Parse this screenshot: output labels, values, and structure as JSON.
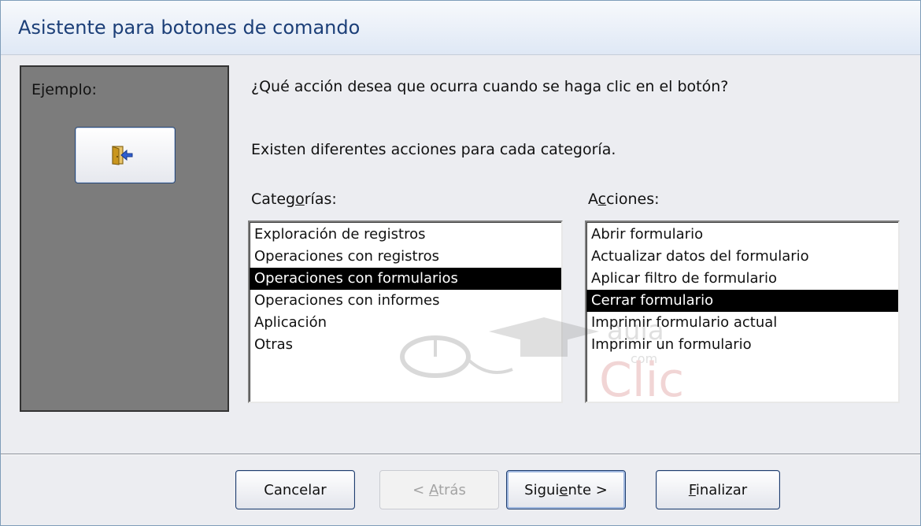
{
  "window": {
    "title": "Asistente para botones de comando"
  },
  "example": {
    "label": "Ejemplo:",
    "button_icon": "exit-door-icon"
  },
  "question": "¿Qué acción desea que ocurra cuando se haga clic en el botón?",
  "info": "Existen diferentes acciones para cada categoría.",
  "categories": {
    "label_before": "Categ",
    "label_mnemonic": "o",
    "label_after": "rías:",
    "items": [
      "Exploración de registros",
      "Operaciones con registros",
      "Operaciones con formularios",
      "Operaciones con informes",
      "Aplicación",
      "Otras"
    ],
    "selected_index": 2
  },
  "actions": {
    "label_before": "A",
    "label_mnemonic": "c",
    "label_after": "ciones:",
    "items": [
      "Abrir formulario",
      "Actualizar datos del formulario",
      "Aplicar filtro de formulario",
      "Cerrar formulario",
      "Imprimir formulario actual",
      "Imprimir un formulario"
    ],
    "selected_index": 3
  },
  "watermark": {
    "brand": "Clic",
    "prefix": "aula",
    "suffix": "com"
  },
  "buttons": {
    "cancel": "Cancelar",
    "back_before": "< ",
    "back_mnemonic": "A",
    "back_after": "trás",
    "next_before": "Sigui",
    "next_mnemonic": "e",
    "next_after": "nte >",
    "finish_mnemonic": "F",
    "finish_after": "inalizar"
  },
  "colors": {
    "selection": "#000000",
    "title_text": "#1c3f78",
    "panel": "#7c7c7c"
  }
}
